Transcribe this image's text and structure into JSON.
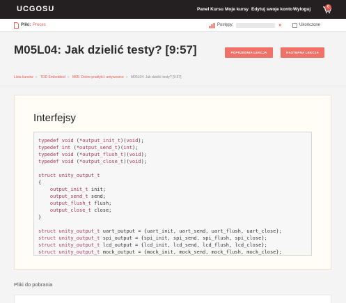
{
  "topbar": {
    "logo": "UCGOSU",
    "nav": [
      "Panel Kursu",
      "Moje kursy",
      "Edytuj swoje konto",
      "Wyloguj"
    ],
    "cart_count": "0"
  },
  "subbar": {
    "files_label": "Pliki:",
    "files_value": "Proces",
    "progress_label": "Postępy:",
    "progress_fraction": 0.0,
    "progress_arrows": "»",
    "done_label": "Ukończone"
  },
  "lesson": {
    "title": "M05L04: Jak dzielić testy? [9:57]",
    "prev_label": "POPRZEDNIA LEKCJA",
    "next_label": "NASTĘPNA LEKCJA"
  },
  "breadcrumb": [
    "Lista kursów",
    "TDD Embedded",
    "M05: Dobre praktyki i antywzorce",
    "M05L04: Jak dzielić testy? [9:57]"
  ],
  "content": {
    "section_title": "Interfejsy",
    "code_lines": [
      "typedef void (*output_init_t)(void);",
      "typedef int (*output_send_t)(int);",
      "typedef void (*output_flush_t)(void);",
      "typedef void (*output_close_t)(void);",
      "",
      "struct unity_output_t",
      "{",
      "    output_init_t init;",
      "    output_send_t send;",
      "    output_flush_t flush;",
      "    output_close_t close;",
      "}",
      "",
      "struct unity_output_t uart_output = {uart_init, uart_send, uart_flush, uart_close};",
      "struct unity_output_t spi_output = {spi_init, spi_send, spi_flush, spi_close};",
      "struct unity_output_t lcd_output = {lcd_init, lcd_send, lcd_flush, lcd_close};",
      "struct unity_output_t mock_output = {mock_init, mock_send, mock_flush, mock_close};"
    ]
  },
  "downloads": {
    "title": "Pliki do pobrania"
  },
  "colors": {
    "accent": "#e8594d",
    "button": "#ef7168",
    "topbar": "#242021"
  }
}
